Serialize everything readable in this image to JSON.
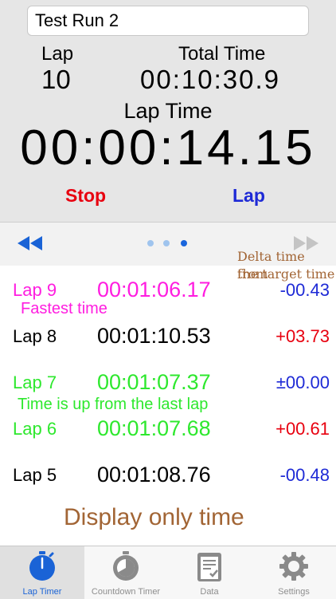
{
  "run_name": "Test Run 2",
  "header": {
    "lap_label": "Lap",
    "lap_number": "10",
    "total_label": "Total Time",
    "total_time": "00:10:30.9",
    "lap_time_label": "Lap Time",
    "lap_time": "00:00:14.15",
    "stop_label": "Stop",
    "lap_button_label": "Lap"
  },
  "pager": {
    "pages": 3,
    "current_page": 3
  },
  "laps": [
    {
      "lap": "Lap 9",
      "time": "00:01:06.17",
      "delta": "-00.43",
      "lap_color": "#ff1de0",
      "delta_color": "#1e2ad6"
    },
    {
      "lap": "Lap 8",
      "time": "00:01:10.53",
      "delta": "+03.73",
      "lap_color": "#000000",
      "delta_color": "#e8000f"
    },
    {
      "lap": "Lap 7",
      "time": "00:01:07.37",
      "delta": "±00.00",
      "lap_color": "#2ee82e",
      "delta_color": "#1e2ad6"
    },
    {
      "lap": "Lap 6",
      "time": "00:01:07.68",
      "delta": "+00.61",
      "lap_color": "#2ee82e",
      "delta_color": "#e8000f"
    },
    {
      "lap": "Lap 5",
      "time": "00:01:08.76",
      "delta": "-00.48",
      "lap_color": "#000000",
      "delta_color": "#1e2ad6"
    }
  ],
  "annotations": {
    "fastest": "Fastest time",
    "delta_line1": "Delta time from",
    "delta_line2": "the target time",
    "time_up": "Time is up from the last lap",
    "display_only": "Display only time"
  },
  "tabs": [
    {
      "label": "Lap Timer",
      "icon": "stopwatch-icon",
      "active": true
    },
    {
      "label": "Countdown Timer",
      "icon": "countdown-timer-icon",
      "active": false
    },
    {
      "label": "Data",
      "icon": "data-clipboard-icon",
      "active": false
    },
    {
      "label": "Settings",
      "icon": "gear-icon",
      "active": false
    }
  ],
  "colors": {
    "accent": "#1a63d6",
    "stop": "#e8000f",
    "lap": "#1e2ad6",
    "fastest": "#ff1de0",
    "slower": "#2ee82e",
    "annotation": "#a26535"
  }
}
